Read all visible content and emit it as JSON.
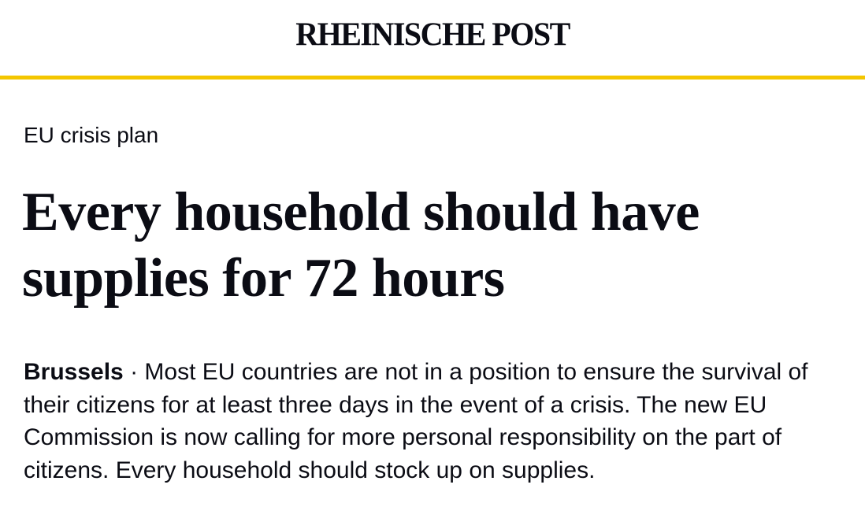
{
  "masthead": {
    "logo_text": "RHEINISCHE POST",
    "accent_color": "#f4c600"
  },
  "article": {
    "kicker": "EU crisis plan",
    "headline": "Every household should have supplies for 72 hours",
    "dateline": "Brussels",
    "separator": " · ",
    "lead": "Most EU countries are not in a position to ensure the survival of their citizens for at least three days in the event of a crisis. The new EU Commission is now calling for more personal responsibility on the part of citizens. Every household should stock up on supplies."
  }
}
